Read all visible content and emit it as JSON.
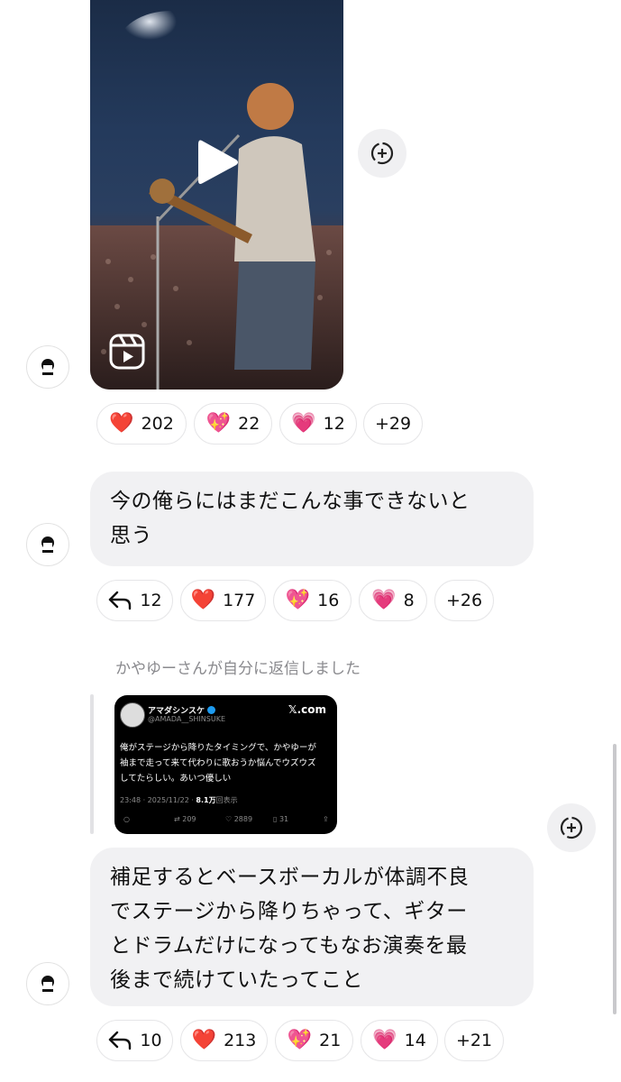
{
  "reel": {
    "reactions": [
      {
        "emoji": "❤️",
        "count": "202"
      },
      {
        "emoji": "💖",
        "count": "22"
      },
      {
        "emoji": "💗",
        "count": "12"
      },
      {
        "extra": "+29"
      }
    ]
  },
  "message1": {
    "text_line1": "今の俺らにはまだこんな事できないと",
    "text_line2": "思う",
    "reply_count": "12",
    "reactions": [
      {
        "emoji": "❤️",
        "count": "177"
      },
      {
        "emoji": "💖",
        "count": "16"
      },
      {
        "emoji": "💗",
        "count": "8"
      },
      {
        "extra": "+26"
      }
    ]
  },
  "reply_note": "かやゆーさんが自分に返信しました",
  "tweet": {
    "name": "アマダシンスケ",
    "handle": "@AMADA__SHINSUKE",
    "source": "𝕏.com",
    "body_line1": "俺がステージから降りたタイミングで、かやゆーが",
    "body_line2": "袖まで走って来て代わりに歌おうか悩んでウズウズ",
    "body_line3": "してたらしい。あいつ優しい",
    "time": "23:48 · 2025/11/22 · ",
    "views": "8.1万",
    "views_suffix": "回表示",
    "retweets": "209",
    "likes": "2889",
    "bookmarks": "31"
  },
  "message2": {
    "line1": "補足するとベースボーカルが体調不良",
    "line2": "でステージから降りちゃって、ギター",
    "line3": "とドラムだけになってもなお演奏を最",
    "line4": "後まで続けていたってこと",
    "reply_count": "10",
    "reactions": [
      {
        "emoji": "❤️",
        "count": "213"
      },
      {
        "emoji": "💖",
        "count": "21"
      },
      {
        "emoji": "💗",
        "count": "14"
      },
      {
        "extra": "+21"
      }
    ]
  }
}
